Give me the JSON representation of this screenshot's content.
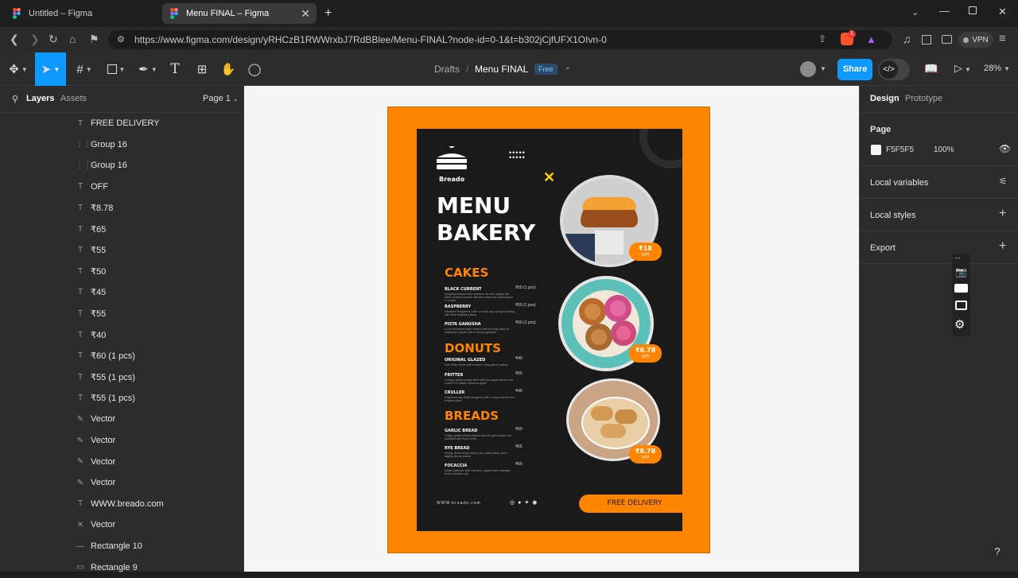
{
  "browser": {
    "tabs": [
      {
        "title": "Untitled – Figma"
      },
      {
        "title": "Menu FINAL – Figma"
      }
    ],
    "url": "https://www.figma.com/design/yRHCzB1RWWrxbJ7RdBBlee/Menu-FINAL?node-id=0-1&t=b302jCjfUFX1OIvn-0",
    "vpn_label": "VPN",
    "shield_count": "1"
  },
  "toolbar": {
    "breadcrumb_root": "Drafts",
    "separator": "/",
    "file_name": "Menu FINAL",
    "plan_badge": "Free",
    "share_label": "Share",
    "zoom": "28%"
  },
  "left_panel": {
    "tab_layers": "Layers",
    "tab_assets": "Assets",
    "page_selector": "Page 1",
    "layers": [
      {
        "icon": "T",
        "name": "FREE DELIVERY"
      },
      {
        "icon": "⋮⋮",
        "name": "Group 16"
      },
      {
        "icon": "⋮⋮",
        "name": "Group 16"
      },
      {
        "icon": "T",
        "name": "OFF"
      },
      {
        "icon": "T",
        "name": "₹8.78"
      },
      {
        "icon": "T",
        "name": "₹65"
      },
      {
        "icon": "T",
        "name": "₹55"
      },
      {
        "icon": "T",
        "name": "₹50"
      },
      {
        "icon": "T",
        "name": "₹45"
      },
      {
        "icon": "T",
        "name": "₹55"
      },
      {
        "icon": "T",
        "name": "₹40"
      },
      {
        "icon": "T",
        "name": "₹60 (1 pcs)"
      },
      {
        "icon": "T",
        "name": "₹55 (1 pcs)"
      },
      {
        "icon": "T",
        "name": "₹55 (1 pcs)"
      },
      {
        "icon": "✎",
        "name": "Vector"
      },
      {
        "icon": "✎",
        "name": "Vector"
      },
      {
        "icon": "✎",
        "name": "Vector"
      },
      {
        "icon": "✎",
        "name": "Vector"
      },
      {
        "icon": "T",
        "name": "WWW.breado.com"
      },
      {
        "icon": "✕",
        "name": "Vector"
      },
      {
        "icon": "—",
        "name": "Rectangle 10"
      },
      {
        "icon": "▭",
        "name": "Rectangle 9"
      }
    ]
  },
  "right_panel": {
    "tab_design": "Design",
    "tab_prototype": "Prototype",
    "page_label": "Page",
    "page_color_hex": "F5F5F5",
    "page_opacity": "100%",
    "local_variables": "Local variables",
    "local_styles": "Local styles",
    "export": "Export"
  },
  "poster": {
    "brand": "Breado",
    "title_line1": "MENU",
    "title_line2": "BAKERY",
    "sections": [
      {
        "title": "CAKES",
        "items": [
          {
            "name": "BLACK CURRENT",
            "price": "₹55 (1 pcs)",
            "desc": "Delightful dessert that combines the rich, slightly tart flavor of black currants with the sweet and moist texture of a cake."
          },
          {
            "name": "RASPBERRY",
            "price": "₹55 (1 pcs)",
            "desc": "Decadent Raspberry Cake: A moist, airy sponge bursting with fresh raspberry flavor."
          },
          {
            "name": "PISTA GANUSHA",
            "price": "₹60 (1 pcs)",
            "desc": "A rich and velvet cake infused with the nutty flavor of pistachios, topped with a creamy ganache."
          }
        ]
      },
      {
        "title": "DONUTS",
        "items": [
          {
            "name": "ORIGINAL GLAZED",
            "price": "₹40",
            "desc": "Soft, fluffy texture with a sweet, shiny glaze coating."
          },
          {
            "name": "FRITTER",
            "price": "₹55",
            "desc": "A crispy, golden pastry filled with juicy apple pieces and coated in a sweet cinnamon glaze."
          },
          {
            "name": "CRULLER",
            "price": "₹45",
            "desc": "A light and airy fluted doughnut with a crispy exterior and a sweet glaze."
          }
        ]
      },
      {
        "title": "BREADS",
        "items": [
          {
            "name": "GARLIC BREAD",
            "price": "₹50",
            "desc": "Crispy, golden bread infused with rich garlic butter and sprinkled with fresh herbs."
          },
          {
            "name": "RYE BREAD",
            "price": "₹55",
            "desc": "Hearty, dense bread with a rich, earthy flavor and a slightly chewy texture."
          },
          {
            "name": "FOCACCIA",
            "price": "₹65",
            "desc": "Italian flatbread, with soft olive, topped with rosemary, herbs, and sea salt."
          }
        ]
      }
    ],
    "badges": [
      {
        "price": "₹18",
        "off": "OFF"
      },
      {
        "price": "₹8.78",
        "off": "OFF"
      },
      {
        "price": "₹8.78",
        "off": "OFF"
      }
    ],
    "website": "WWW.breado.com",
    "delivery": "FREE DELIVERY"
  },
  "colors": {
    "accent": "#0d99ff",
    "poster_orange": "#ff8400",
    "poster_dark": "#1b1a1a",
    "canvas_bg": "#f5f5f5"
  }
}
